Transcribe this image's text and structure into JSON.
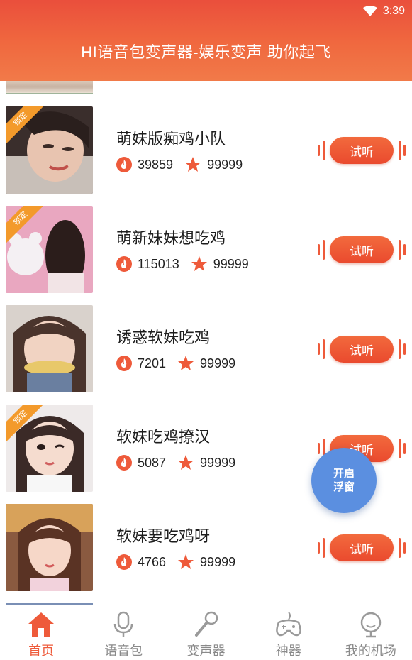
{
  "status_bar": {
    "time": "3:39"
  },
  "header": {
    "title": "HI语音包变声器-娱乐变声 助你起飞"
  },
  "items": [
    {
      "title": "萌妹版痴鸡小队",
      "plays": "39859",
      "likes": "99999",
      "locked": true,
      "lock_label": "锁定",
      "listen": "试听"
    },
    {
      "title": "萌新妹妹想吃鸡",
      "plays": "115013",
      "likes": "99999",
      "locked": true,
      "lock_label": "锁定",
      "listen": "试听"
    },
    {
      "title": "诱惑软妹吃鸡",
      "plays": "7201",
      "likes": "99999",
      "locked": false,
      "lock_label": "",
      "listen": "试听"
    },
    {
      "title": "软妹吃鸡撩汉",
      "plays": "5087",
      "likes": "99999",
      "locked": true,
      "lock_label": "锁定",
      "listen": "试听"
    },
    {
      "title": "软妹要吃鸡呀",
      "plays": "4766",
      "likes": "99999",
      "locked": false,
      "lock_label": "",
      "listen": "试听"
    }
  ],
  "float_button": {
    "line1": "开启",
    "line2": "浮窗"
  },
  "tabs": [
    {
      "label": "首页",
      "icon": "home-icon",
      "active": true
    },
    {
      "label": "语音包",
      "icon": "microphone-icon",
      "active": false
    },
    {
      "label": "变声器",
      "icon": "karaoke-mic-icon",
      "active": false
    },
    {
      "label": "神器",
      "icon": "gamepad-icon",
      "active": false
    },
    {
      "label": "我的机场",
      "icon": "profile-icon",
      "active": false
    }
  ],
  "colors": {
    "accent": "#ee5a3a",
    "float": "#5b8fe0",
    "lock": "#f39a2b"
  }
}
